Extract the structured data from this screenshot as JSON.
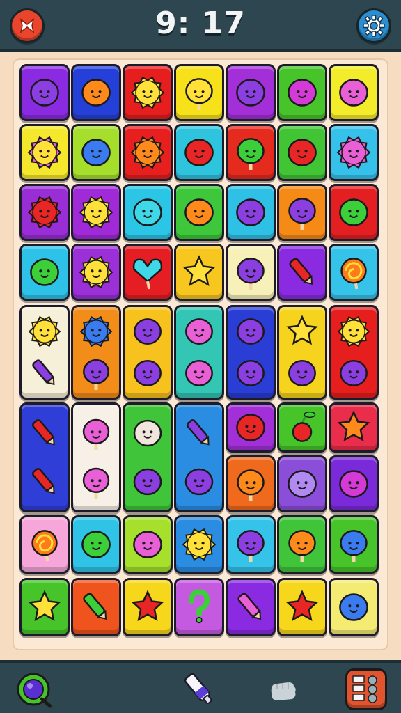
{
  "header": {
    "timer": "9: 17",
    "close_icon": "close-icon",
    "settings_icon": "gear-icon",
    "colors": {
      "bar": "#2d4650",
      "close": "#e8452c",
      "settings": "#2a8fd2"
    }
  },
  "board": {
    "columns": 7,
    "tiles": [
      {
        "row": 0,
        "col": 0,
        "rowspan": 1,
        "color": "#8a2be2",
        "icon": "purple-blob-monster"
      },
      {
        "row": 0,
        "col": 1,
        "rowspan": 1,
        "color": "#2540d8",
        "icon": "orange-robot"
      },
      {
        "row": 0,
        "col": 2,
        "rowspan": 1,
        "color": "#e61e1e",
        "icon": "yellow-sun-face"
      },
      {
        "row": 0,
        "col": 3,
        "rowspan": 1,
        "color": "#f6e11a",
        "icon": "yellow-balloon-cat"
      },
      {
        "row": 0,
        "col": 4,
        "rowspan": 1,
        "color": "#a32fd8",
        "icon": "purple-cat-face"
      },
      {
        "row": 0,
        "col": 5,
        "rowspan": 1,
        "color": "#47c42a",
        "icon": "magenta-blob-face"
      },
      {
        "row": 0,
        "col": 6,
        "rowspan": 1,
        "color": "#f3ec2a",
        "icon": "pink-blob-face"
      },
      {
        "row": 1,
        "col": 0,
        "rowspan": 1,
        "color": "#f4e72c",
        "icon": "flower-face"
      },
      {
        "row": 1,
        "col": 1,
        "rowspan": 1,
        "color": "#a6de2c",
        "icon": "blue-ghost"
      },
      {
        "row": 1,
        "col": 2,
        "rowspan": 1,
        "color": "#e81f1f",
        "icon": "orange-sun-face"
      },
      {
        "row": 1,
        "col": 3,
        "rowspan": 1,
        "color": "#2fc4de",
        "icon": "red-horn"
      },
      {
        "row": 1,
        "col": 4,
        "rowspan": 1,
        "color": "#e52a1e",
        "icon": "green-spiral-tree"
      },
      {
        "row": 1,
        "col": 5,
        "rowspan": 1,
        "color": "#41c534",
        "icon": "red-pear"
      },
      {
        "row": 1,
        "col": 6,
        "rowspan": 1,
        "color": "#36c1ea",
        "icon": "pink-spiky-face"
      },
      {
        "row": 2,
        "col": 0,
        "rowspan": 1,
        "color": "#9a2ed6",
        "icon": "red-spiky-face"
      },
      {
        "row": 2,
        "col": 1,
        "rowspan": 1,
        "color": "#a12ad8",
        "icon": "yellow-spiky-face"
      },
      {
        "row": 2,
        "col": 2,
        "rowspan": 1,
        "color": "#2bc5e6",
        "icon": "cyan-blob"
      },
      {
        "row": 2,
        "col": 3,
        "rowspan": 1,
        "color": "#3ec73a",
        "icon": "orange-bird"
      },
      {
        "row": 2,
        "col": 4,
        "rowspan": 1,
        "color": "#2fc0e6",
        "icon": "purple-onion"
      },
      {
        "row": 2,
        "col": 5,
        "rowspan": 1,
        "color": "#f58a16",
        "icon": "purple-mushroom"
      },
      {
        "row": 2,
        "col": 6,
        "rowspan": 1,
        "color": "#e41f21",
        "icon": "green-leaf-sprout"
      },
      {
        "row": 3,
        "col": 0,
        "rowspan": 1,
        "color": "#2ec2e9",
        "icon": "green-ghost"
      },
      {
        "row": 3,
        "col": 1,
        "rowspan": 1,
        "color": "#9b2fd8",
        "icon": "yellow-spiky-face"
      },
      {
        "row": 3,
        "col": 2,
        "rowspan": 1,
        "color": "#e51e23",
        "icon": "cyan-heart-pop"
      },
      {
        "row": 3,
        "col": 3,
        "rowspan": 1,
        "color": "#f7c61f",
        "icon": "yellow-star"
      },
      {
        "row": 3,
        "col": 4,
        "rowspan": 1,
        "color": "#f7f0b8",
        "icon": "purple-balloon"
      },
      {
        "row": 3,
        "col": 5,
        "rowspan": 1,
        "color": "#8a2be2",
        "icon": "red-crayon"
      },
      {
        "row": 3,
        "col": 6,
        "rowspan": 1,
        "color": "#36c3ea",
        "icon": "lollipop-swirl"
      },
      {
        "row": 4,
        "col": 0,
        "rowspan": 2,
        "color": "#f7f0d8",
        "icon": "sun-face-and-tube"
      },
      {
        "row": 4,
        "col": 1,
        "rowspan": 2,
        "color": "#f38d1a",
        "icon": "blue-spiky-and-pop"
      },
      {
        "row": 4,
        "col": 2,
        "rowspan": 2,
        "color": "#f7c21d",
        "icon": "leaf-and-fish"
      },
      {
        "row": 4,
        "col": 3,
        "rowspan": 2,
        "color": "#33c6b5",
        "icon": "red-face-pink-face"
      },
      {
        "row": 4,
        "col": 4,
        "rowspan": 2,
        "color": "#2a3ed6",
        "icon": "monster-and-octopus"
      },
      {
        "row": 4,
        "col": 5,
        "rowspan": 2,
        "color": "#f6d31c",
        "icon": "star-and-rock"
      },
      {
        "row": 4,
        "col": 6,
        "rowspan": 2,
        "color": "#e61e1e",
        "icon": "sun-and-face"
      },
      {
        "row": 6,
        "col": 0,
        "rowspan": 2,
        "color": "#2f3ed6",
        "icon": "green-tube-red-face"
      },
      {
        "row": 6,
        "col": 1,
        "rowspan": 2,
        "color": "#f7f0e6",
        "icon": "red-cloth-pink-balloon"
      },
      {
        "row": 6,
        "col": 2,
        "rowspan": 2,
        "color": "#40c43a",
        "icon": "cow-and-cat"
      },
      {
        "row": 6,
        "col": 3,
        "rowspan": 2,
        "color": "#2a8de2",
        "icon": "crayon-and-bubble"
      },
      {
        "row": 6,
        "col": 4,
        "rowspan": 1,
        "color": "#a32fd8",
        "icon": "red-cat-face"
      },
      {
        "row": 6,
        "col": 5,
        "rowspan": 1,
        "color": "#47c42a",
        "icon": "cherry"
      },
      {
        "row": 6,
        "col": 6,
        "rowspan": 1,
        "color": "#ea2d4a",
        "icon": "orange-star"
      },
      {
        "row": 7,
        "col": 4,
        "rowspan": 1,
        "color": "#f06a1e",
        "icon": "orange-balloon"
      },
      {
        "row": 7,
        "col": 5,
        "rowspan": 1,
        "color": "#8a4ed8",
        "icon": "lilac-blob-face"
      },
      {
        "row": 7,
        "col": 6,
        "rowspan": 1,
        "color": "#7a2ad8",
        "icon": "magenta-drop-face"
      },
      {
        "row": 8,
        "col": 0,
        "rowspan": 1,
        "color": "#f6a6d8",
        "icon": "lollipop-swirl"
      },
      {
        "row": 8,
        "col": 1,
        "rowspan": 1,
        "color": "#2fc4e6",
        "icon": "green-blob"
      },
      {
        "row": 8,
        "col": 2,
        "rowspan": 1,
        "color": "#a6e02c",
        "icon": "pink-striped-fish"
      },
      {
        "row": 8,
        "col": 3,
        "rowspan": 1,
        "color": "#2a8de2",
        "icon": "yellow-sun-face"
      },
      {
        "row": 8,
        "col": 4,
        "rowspan": 1,
        "color": "#36c3ea",
        "icon": "purple-ice-pop"
      },
      {
        "row": 8,
        "col": 5,
        "rowspan": 1,
        "color": "#3fc43a",
        "icon": "orange-pop"
      },
      {
        "row": 8,
        "col": 6,
        "rowspan": 1,
        "color": "#47c42a",
        "icon": "blue-pop-face"
      },
      {
        "row": 9,
        "col": 0,
        "rowspan": 1,
        "color": "#47c42a",
        "icon": "yellow-star"
      },
      {
        "row": 9,
        "col": 1,
        "rowspan": 1,
        "color": "#f0541e",
        "icon": "green-marker"
      },
      {
        "row": 9,
        "col": 2,
        "rowspan": 1,
        "color": "#f7d71c",
        "icon": "red-star"
      },
      {
        "row": 9,
        "col": 3,
        "rowspan": 1,
        "color": "#c45ae0",
        "icon": "green-question-mark"
      },
      {
        "row": 9,
        "col": 4,
        "rowspan": 1,
        "color": "#8a2be2",
        "icon": "pink-crayon"
      },
      {
        "row": 9,
        "col": 5,
        "rowspan": 1,
        "color": "#f7d71c",
        "icon": "red-diamond-star"
      },
      {
        "row": 9,
        "col": 6,
        "rowspan": 1,
        "color": "#f4ec72",
        "icon": "blue-bean-face"
      }
    ]
  },
  "footer": {
    "hint_icon": "magnifier-orb-icon",
    "brush_icon": "paint-tube-icon",
    "hand_icon": "hand-icon",
    "menu_icon": "grid-menu-icon",
    "colors": {
      "menu": "#e2542f",
      "hint": "#47c42a"
    }
  }
}
